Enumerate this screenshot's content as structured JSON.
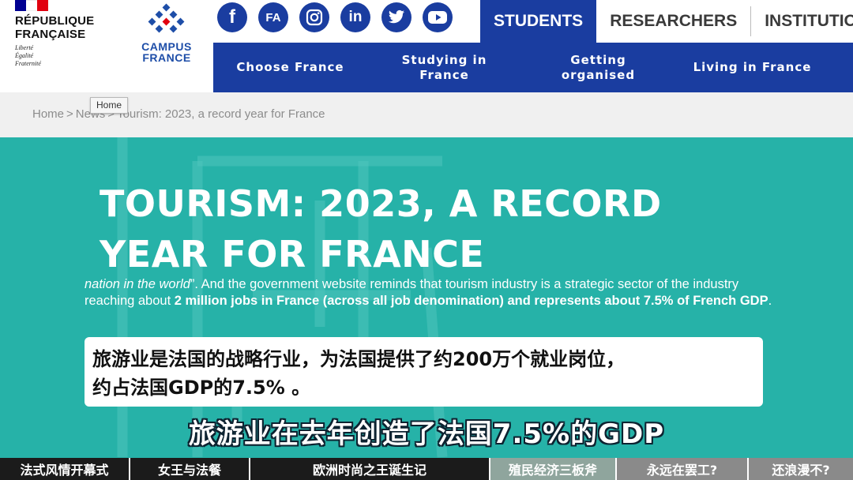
{
  "republique": {
    "title_line1": "RÉPUBLIQUE",
    "title_line2": "FRANÇAISE",
    "motto_1": "Liberté",
    "motto_2": "Égalité",
    "motto_3": "Fraternité",
    "flag_colors": [
      "#000091",
      "#ffffff",
      "#e1000f"
    ]
  },
  "campus_france": {
    "line1": "CAMPUS",
    "line2": "FRANCE",
    "brand_color": "#1e4ea8",
    "accent_color": "#e1000f"
  },
  "social": [
    {
      "icon": "facebook-icon",
      "glyph": "f"
    },
    {
      "icon": "fa-icon",
      "glyph": "FA"
    },
    {
      "icon": "instagram-icon",
      "glyph": ""
    },
    {
      "icon": "linkedin-icon",
      "glyph": "in"
    },
    {
      "icon": "twitter-icon",
      "glyph": ""
    },
    {
      "icon": "youtube-icon",
      "glyph": ""
    }
  ],
  "audience_tabs": [
    {
      "label": "STUDENTS",
      "active": true
    },
    {
      "label": "RESEARCHERS",
      "active": false
    },
    {
      "label": "INSTITUTIO",
      "active": false
    }
  ],
  "main_nav": [
    {
      "label": "Choose France"
    },
    {
      "label": "Studying in France"
    },
    {
      "label": "Getting organised"
    },
    {
      "label": "Living in France"
    }
  ],
  "breadcrumb": {
    "home": "Home",
    "news": "News",
    "current": "Tourism: 2023, a record year for France",
    "separator": ">"
  },
  "tooltip": "Home",
  "hero": {
    "title_line1": "TOURISM: 2023, A RECORD",
    "title_line2": "YEAR FOR FRANCE",
    "body_italic": "nation in the world",
    "body_after_italic": "”. And the government website reminds that tourism industry is a strategic sector of the industry reaching about ",
    "body_bold": "2 million jobs in France (across all job denomination) and represents about 7.5% of French GDP",
    "body_end": ".",
    "background_color": "#26b2a8"
  },
  "subtitle": {
    "box_line1": "旅游业是法国的战略行业，为法国提供了约200万个就业岗位，",
    "box_line2": "约占法国GDP的7.5% 。",
    "caption": "旅游业在去年创造了法国7.5%的GDP"
  },
  "chapters": [
    {
      "label": "法式风情开幕式"
    },
    {
      "label": "女王与法餐"
    },
    {
      "label": "欧洲时尚之王诞生记"
    },
    {
      "label": "殖民经济三板斧"
    },
    {
      "label": "永远在罢工?"
    },
    {
      "label": "还浪漫不?"
    }
  ]
}
